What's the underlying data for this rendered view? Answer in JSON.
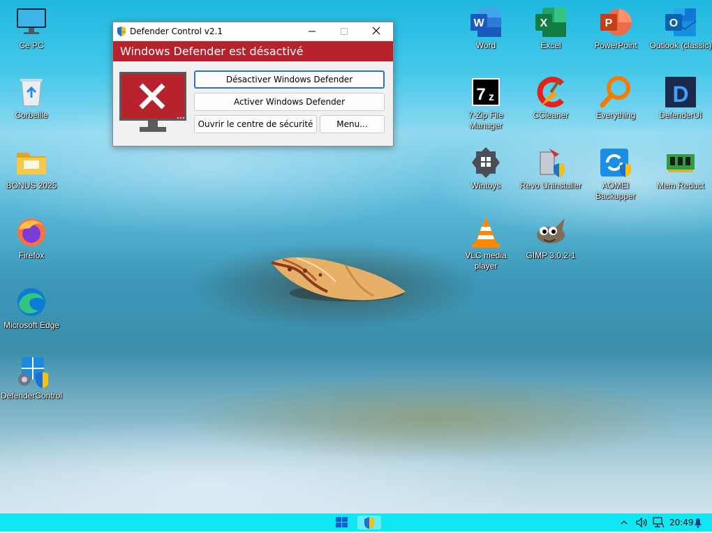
{
  "desktop": {
    "left_icons": [
      {
        "label": "Ce PC",
        "icon": "computer-icon"
      },
      {
        "label": "Corbeille",
        "icon": "recycle-bin-icon"
      },
      {
        "label": "BONUS 2025",
        "icon": "folder-icon"
      },
      {
        "label": "Firefox",
        "icon": "firefox-icon"
      },
      {
        "label": "Microsoft Edge",
        "icon": "edge-icon"
      },
      {
        "label": "DefenderControl",
        "icon": "defender-control-icon"
      }
    ],
    "right_icons": [
      {
        "label": "Word",
        "icon": "word-icon"
      },
      {
        "label": "Excel",
        "icon": "excel-icon"
      },
      {
        "label": "PowerPoint",
        "icon": "powerpoint-icon"
      },
      {
        "label": "Outlook (classic)",
        "icon": "outlook-icon"
      },
      {
        "label": "7-Zip File\nManager",
        "icon": "7zip-icon"
      },
      {
        "label": "CCleaner",
        "icon": "ccleaner-icon"
      },
      {
        "label": "Everything",
        "icon": "everything-icon"
      },
      {
        "label": "DefenderUI",
        "icon": "defenderui-icon"
      },
      {
        "label": "Wintoys",
        "icon": "wintoys-icon"
      },
      {
        "label": "Revo Uninstaller",
        "icon": "revo-uninstaller-icon"
      },
      {
        "label": "AOMEI\nBackupper",
        "icon": "aomei-backupper-icon"
      },
      {
        "label": "Mem Reduct",
        "icon": "mem-reduct-icon"
      },
      {
        "label": "VLC media\nplayer",
        "icon": "vlc-icon"
      },
      {
        "label": "GIMP 3.0.2-1",
        "icon": "gimp-icon"
      }
    ]
  },
  "window": {
    "title": "Defender Control v2.1",
    "status_banner": "Windows Defender est désactivé",
    "status_color": "#b7232c",
    "buttons": {
      "disable": "Désactiver Windows Defender",
      "enable": "Activer Windows Defender",
      "security_center": "Ouvrir le centre de sécurité",
      "menu": "Menu..."
    }
  },
  "taskbar": {
    "accent": "#11e6f3",
    "pinned": [
      {
        "icon": "windows-start-icon"
      },
      {
        "icon": "defender-control-icon"
      }
    ],
    "tray": {
      "clock": "20:49",
      "icons": [
        "chevron-up-icon",
        "speaker-icon",
        "network-icon",
        "bell-icon"
      ]
    }
  }
}
